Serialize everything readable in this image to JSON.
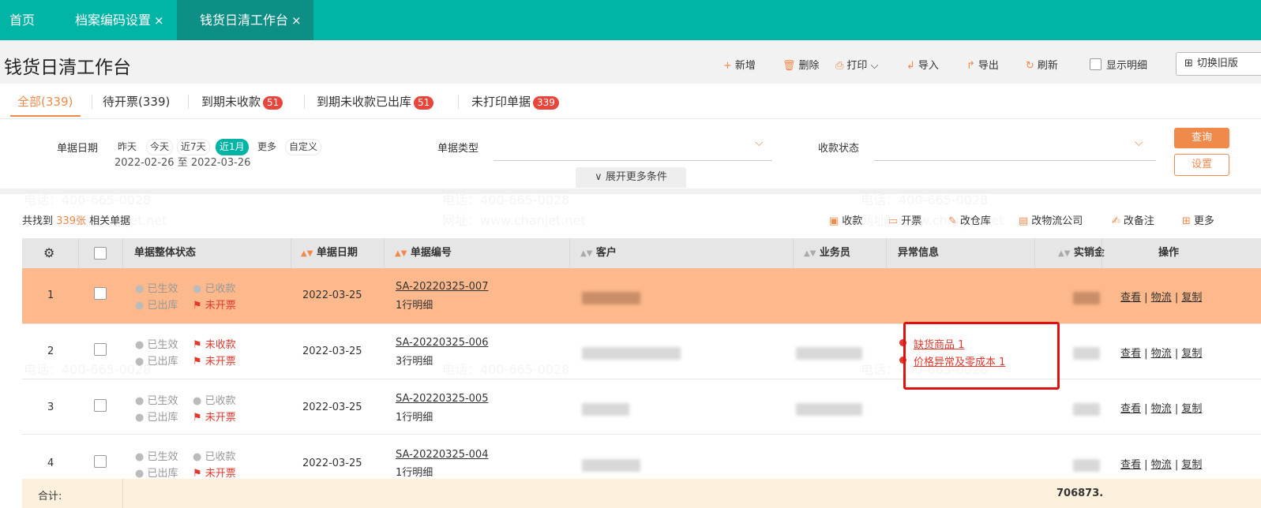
{
  "top_tabs": [
    {
      "label": "首页",
      "closable": false
    },
    {
      "label": "档案编码设置",
      "closable": true
    },
    {
      "label": "钱货日清工作台",
      "closable": true,
      "active": true
    }
  ],
  "close_glyph": "×",
  "page_title": "钱货日清工作台",
  "toolbar": {
    "add": "新增",
    "delete": "删除",
    "print": "打印",
    "import": "导入",
    "export": "导出",
    "refresh": "刷新",
    "show_detail": "显示明细",
    "switch_old": "切换旧版"
  },
  "filter_tabs": [
    {
      "label": "全部(339)",
      "badge": ""
    },
    {
      "label": "待开票(339)",
      "badge": ""
    },
    {
      "label": "到期未收款",
      "badge": "51"
    },
    {
      "label": "到期未收款已出库",
      "badge": "51"
    },
    {
      "label": "未打印单据",
      "badge": "339"
    }
  ],
  "filters": {
    "date_label": "单据日期",
    "date_chips": [
      "昨天",
      "今天",
      "近7天",
      "近1月",
      "更多",
      "自定义"
    ],
    "date_range": "2022-02-26 至 2022-03-26",
    "doc_type_label": "单据类型",
    "pay_status_label": "收款状态",
    "expand_more": "展开更多条件",
    "query_button": "查询",
    "settings_button": "设置"
  },
  "summary": {
    "prefix": "共找到",
    "count": "339张",
    "suffix": "相关单据"
  },
  "batch_actions": [
    "收款",
    "开票",
    "改仓库",
    "改物流公司",
    "改备注",
    "更多"
  ],
  "columns": [
    "单据整体状态",
    "单据日期",
    "单据编号",
    "客户",
    "业务员",
    "异常信息",
    "实销金",
    "操作"
  ],
  "rows": [
    {
      "index": "1",
      "status": [
        "已生效",
        "已收款",
        "已出库",
        "未开票"
      ],
      "date": "2022-03-25",
      "doc_no": "SA-20220325-007",
      "detail": "1行明细",
      "anomalies": []
    },
    {
      "index": "2",
      "status": [
        "已生效",
        "未收款",
        "已出库",
        "未开票"
      ],
      "date": "2022-03-25",
      "doc_no": "SA-20220325-006",
      "detail": "3行明细",
      "anomalies": [
        "缺货商品 1",
        "价格异常及零成本 1"
      ]
    },
    {
      "index": "3",
      "status": [
        "已生效",
        "已收款",
        "已出库",
        "未开票"
      ],
      "date": "2022-03-25",
      "doc_no": "SA-20220325-005",
      "detail": "1行明细",
      "anomalies": []
    },
    {
      "index": "4",
      "status": [
        "已生效",
        "已收款",
        "已出库",
        "未开票"
      ],
      "date": "2022-03-25",
      "doc_no": "SA-20220325-004",
      "detail": "1行明细",
      "anomalies": []
    }
  ],
  "row_ops": [
    "查看",
    "物流",
    "复制"
  ],
  "total": {
    "label": "合计:",
    "amount": "706873."
  },
  "watermark": {
    "phone": "电话：400-665-0028",
    "site": "网址：www.chanjet.net"
  },
  "colors": {
    "teal": "#00b4a6",
    "orange": "#f08a4b",
    "highlight_row": "#fdb98b",
    "red": "#e03a2f"
  }
}
